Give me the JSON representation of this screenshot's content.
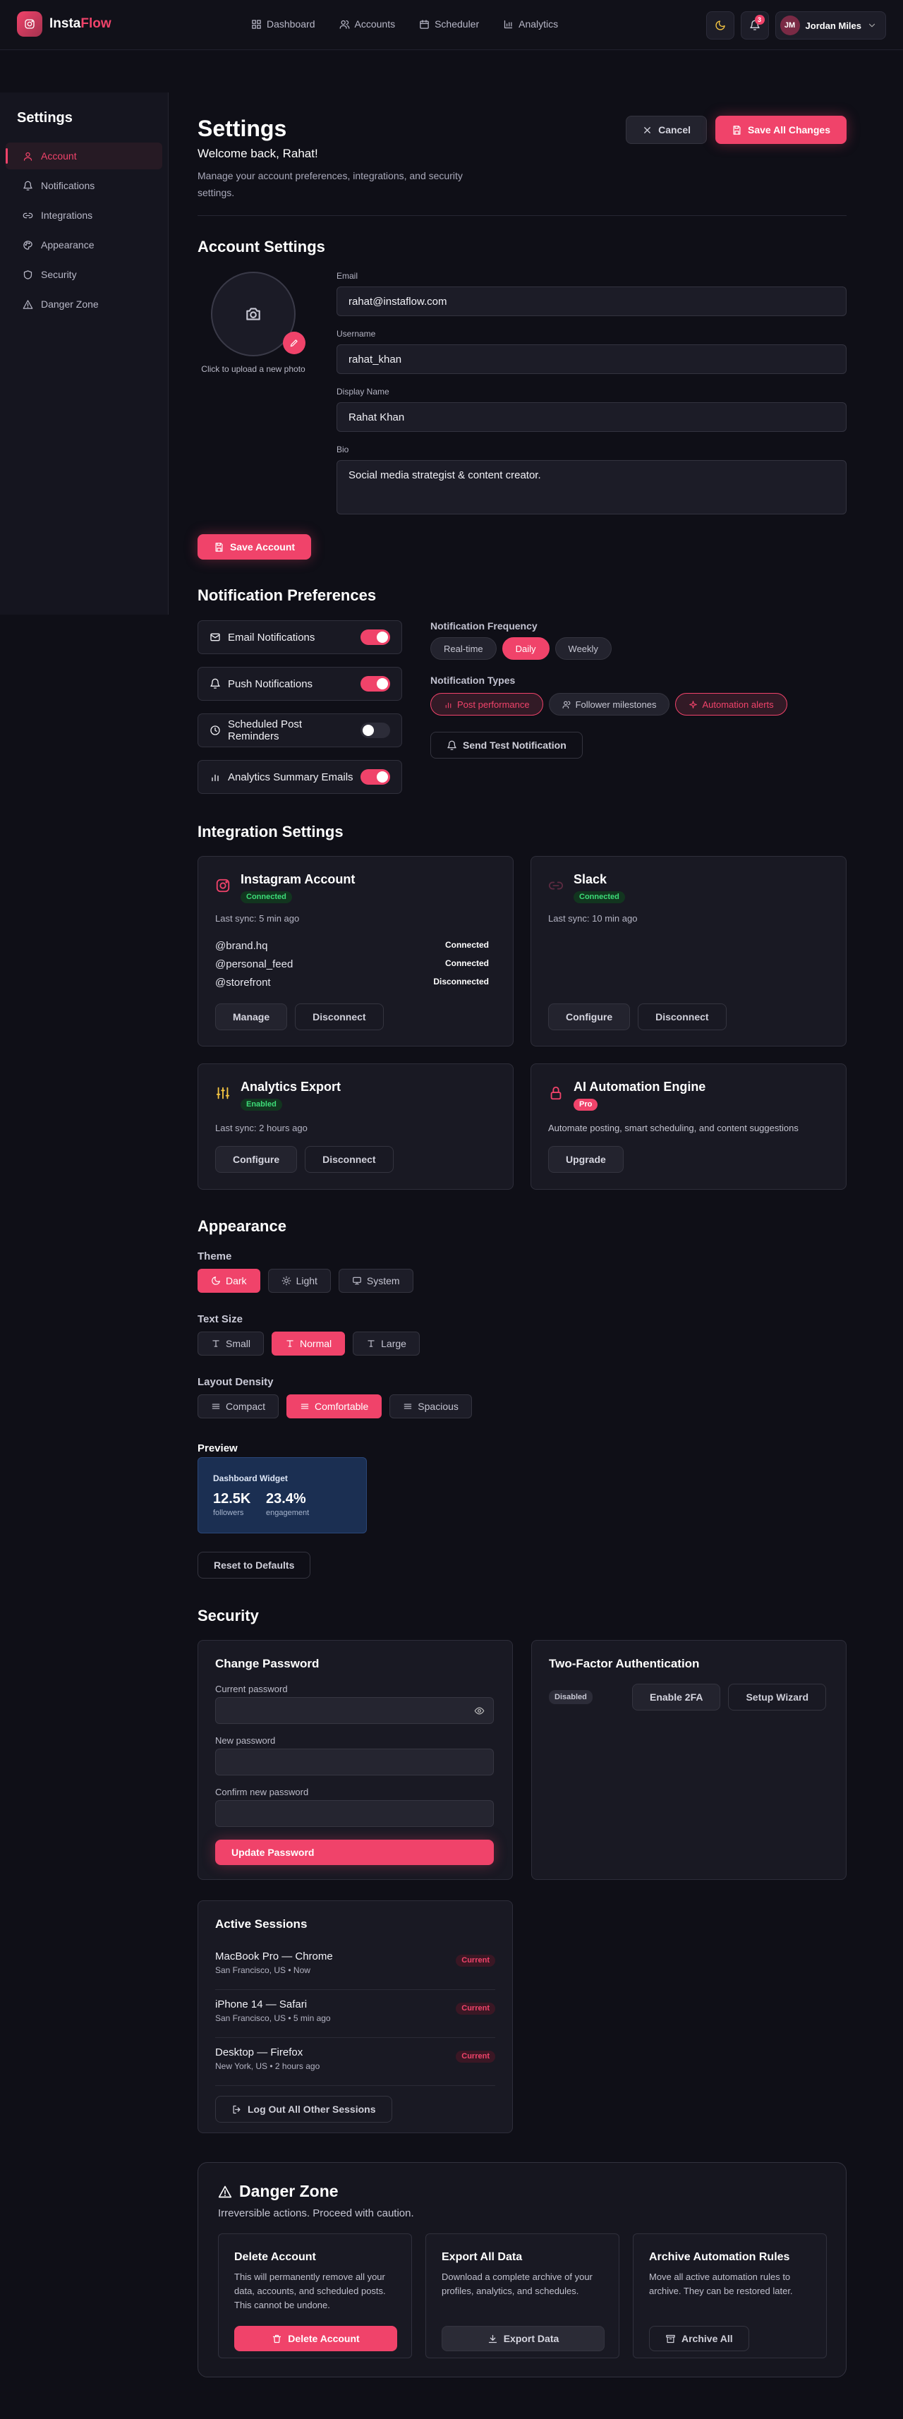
{
  "nav": {
    "brand_part1": "Insta",
    "brand_part2": "Flow",
    "links": [
      {
        "label": "Dashboard"
      },
      {
        "label": "Accounts"
      },
      {
        "label": "Scheduler"
      },
      {
        "label": "Analytics"
      }
    ],
    "notification_count": "3",
    "user_initials": "JM",
    "user_name": "Jordan Miles"
  },
  "sidebar": {
    "title": "Settings",
    "items": [
      {
        "label": "Account",
        "icon": "user-icon",
        "active": true
      },
      {
        "label": "Notifications",
        "icon": "bell-icon"
      },
      {
        "label": "Integrations",
        "icon": "link-icon"
      },
      {
        "label": "Appearance",
        "icon": "palette-icon"
      },
      {
        "label": "Security",
        "icon": "shield-icon"
      },
      {
        "label": "Danger Zone",
        "icon": "warning-icon"
      }
    ]
  },
  "header": {
    "title": "Settings",
    "welcome": "Welcome back, Rahat!",
    "subtitle": "Manage your account preferences, integrations, and security settings.",
    "cancel_label": "Cancel",
    "save_all_label": "Save All Changes"
  },
  "account": {
    "title": "Account Settings",
    "photo_caption": "Click to upload a new photo",
    "email_label": "Email",
    "email_value": "rahat@instaflow.com",
    "username_label": "Username",
    "username_value": "rahat_khan",
    "display_label": "Display Name",
    "display_value": "Rahat Khan",
    "bio_label": "Bio",
    "bio_value": "Social media strategist & content creator.",
    "save_label": "Save Account"
  },
  "notifications": {
    "title": "Notification Preferences",
    "toggles": [
      {
        "label": "Email Notifications",
        "on": true
      },
      {
        "label": "Push Notifications",
        "on": true
      },
      {
        "label": "Scheduled Post Reminders",
        "on": false
      },
      {
        "label": "Analytics Summary Emails",
        "on": true
      }
    ],
    "frequency_label": "Notification Frequency",
    "frequency_options": [
      "Real-time",
      "Daily",
      "Weekly"
    ],
    "frequency_selected": "Daily",
    "types_label": "Notification Types",
    "types": [
      "Post performance",
      "Follower milestones",
      "Automation alerts"
    ],
    "test_label": "Send Test Notification"
  },
  "integrations": {
    "title": "Integration Settings",
    "instagram": {
      "name": "Instagram Account",
      "status": "Connected",
      "sync": "Last sync: 5 min ago",
      "accounts": [
        {
          "handle": "@brand.hq",
          "status": "Connected"
        },
        {
          "handle": "@personal_feed",
          "status": "Connected"
        },
        {
          "handle": "@storefront",
          "status": "Disconnected"
        }
      ],
      "btn1": "Manage",
      "btn2": "Disconnect"
    },
    "slack": {
      "name": "Slack",
      "status": "Connected",
      "sync": "Last sync: 10 min ago",
      "btn1": "Configure",
      "btn2": "Disconnect"
    },
    "analytics": {
      "name": "Analytics Export",
      "status": "Enabled",
      "sync": "Last sync: 2 hours ago",
      "btn1": "Configure",
      "btn2": "Disconnect"
    },
    "ai": {
      "name": "AI Automation Engine",
      "status": "Pro",
      "desc": "Automate posting, smart scheduling, and content suggestions",
      "btn1": "Upgrade"
    }
  },
  "appearance": {
    "title": "Appearance",
    "theme_label": "Theme",
    "theme_options": [
      "Dark",
      "Light",
      "System"
    ],
    "text_label": "Text Size",
    "text_options": [
      "Small",
      "Normal",
      "Large"
    ],
    "density_label": "Layout Density",
    "density_options": [
      "Compact",
      "Comfortable",
      "Spacious"
    ],
    "preview_label": "Preview",
    "widget_title": "Dashboard Widget",
    "stat1_value": "12.5K",
    "stat1_caption": "followers",
    "stat2_value": "23.4%",
    "stat2_caption": "engagement",
    "reset_label": "Reset to Defaults"
  },
  "security": {
    "title": "Security",
    "pw_title": "Change Password",
    "current_label": "Current password",
    "new_label": "New password",
    "confirm_label": "Confirm new password",
    "update_label": "Update Password",
    "twofa_title": "Two-Factor Authentication",
    "twofa_status": "Disabled",
    "enable_label": "Enable 2FA",
    "wizard_label": "Setup Wizard",
    "sessions_title": "Active Sessions",
    "sessions": [
      {
        "device": "MacBook Pro — Chrome",
        "meta": "San Francisco, US • Now",
        "badge": "Current"
      },
      {
        "device": "iPhone 14 — Safari",
        "meta": "San Francisco, US • 5 min ago",
        "badge": "Current"
      },
      {
        "device": "Desktop — Firefox",
        "meta": "New York, US • 2 hours ago",
        "badge": "Current"
      }
    ],
    "logout_label": "Log Out All Other Sessions"
  },
  "danger": {
    "title": "Danger Zone",
    "subtitle": "Irreversible actions. Proceed with caution.",
    "cards": [
      {
        "title": "Delete Account",
        "desc": "This will permanently remove all your data, accounts, and scheduled posts. This cannot be undone.",
        "btn": "Delete Account"
      },
      {
        "title": "Export All Data",
        "desc": "Download a complete archive of your profiles, analytics, and schedules.",
        "btn": "Export Data"
      },
      {
        "title": "Archive Automation Rules",
        "desc": "Move all active automation rules to archive. They can be restored later.",
        "btn": "Archive All"
      }
    ]
  },
  "colors": {
    "accent": "#f0436a",
    "background": "#0f0f17",
    "success": "#3ddc78"
  }
}
